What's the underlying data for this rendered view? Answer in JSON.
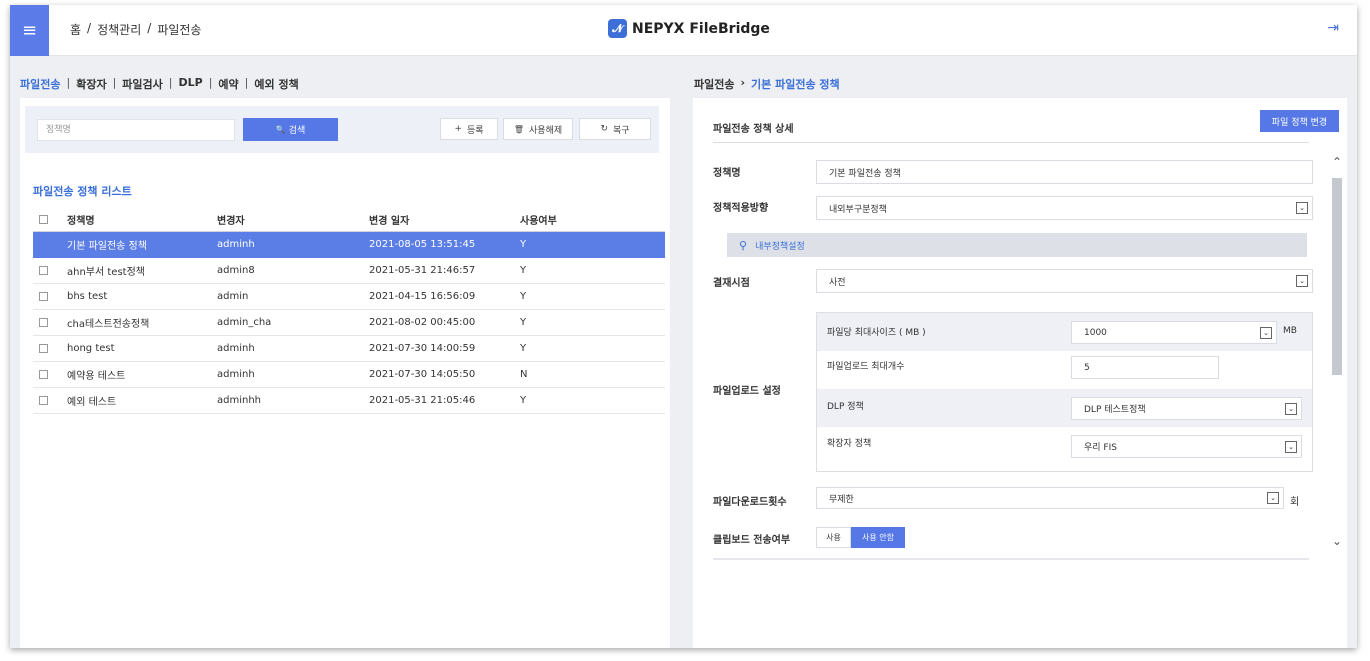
{
  "header": {
    "menu_icon": "≡",
    "breadcrumb": [
      "홈",
      "/",
      "정책관리",
      "/",
      "파일전송"
    ],
    "logo_mark": "𝓝",
    "logo_text": "NEPYX FileBridge",
    "logout_icon": "⇥"
  },
  "tabs": [
    "파일전송",
    "|",
    "확장자",
    "|",
    "파일검사",
    "|",
    "DLP",
    "|",
    "예약",
    "|",
    "예외 정책"
  ],
  "search": {
    "placeholder": "정책명",
    "search_label": "검색",
    "search_icon": "🔍",
    "register_label": "등록",
    "register_icon": "+",
    "disable_label": "사용해제",
    "disable_icon": "🗑",
    "restore_label": "복구",
    "restore_icon": "↻"
  },
  "list": {
    "title": "파일전송 정책 리스트",
    "headers": [
      "정책명",
      "변경자",
      "변경 일자",
      "사용여부"
    ],
    "rows": [
      [
        "기본 파일전송 정책",
        "adminh",
        "2021-08-05 13:51:45",
        "Y"
      ],
      [
        "ahn부서 test정책",
        "admin8",
        "2021-05-31 21:46:57",
        "Y"
      ],
      [
        "bhs test",
        "admin",
        "2021-04-15 16:56:09",
        "Y"
      ],
      [
        "cha테스트전송정책",
        "admin_cha",
        "2021-08-02 00:45:00",
        "Y"
      ],
      [
        "hong test",
        "adminh",
        "2021-07-30 14:00:59",
        "Y"
      ],
      [
        "예약용 테스트",
        "adminh",
        "2021-07-30 14:05:50",
        "N"
      ],
      [
        "예외 테스트",
        "adminhh",
        "2021-05-31 21:05:46",
        "Y"
      ]
    ],
    "selected_index": 0
  },
  "right_breadcrumb": [
    "파일전송",
    "›",
    "기본 파일전송 정책"
  ],
  "detail": {
    "title": "파일전송 정책 상세",
    "change_button": "파일 정책 변경",
    "policy_name_label": "정책명",
    "policy_name_value": "기본 파일전송 정책",
    "direction_label": "정책적용방향",
    "direction_value": "내외부구분정책",
    "inner_icon": "⚲",
    "inner_label": "내부정책설정",
    "approval_label": "결재시점",
    "approval_value": "사전",
    "upload_label": "파일업로드 설정",
    "max_size_label": "파일당 최대사이즈 ( MB )",
    "max_size_value": "1000",
    "max_size_unit": "MB",
    "max_count_label": "파일업로드 최대개수",
    "max_count_value": "5",
    "dlp_label": "DLP 정책",
    "dlp_value": "DLP 테스트정책",
    "ext_label": "확장자 정책",
    "ext_value": "우리 FIS",
    "download_label": "파일다운로드횟수",
    "download_value": "무제한",
    "download_unit": "회",
    "clipboard_label": "클립보드 전송여부",
    "clipboard_on": "사용",
    "clipboard_off": "사용 안함",
    "select_arrow": "⌄"
  }
}
